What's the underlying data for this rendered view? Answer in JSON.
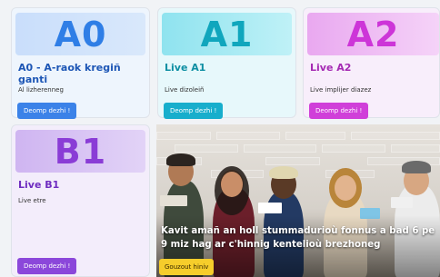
{
  "cards": [
    {
      "code": "A0",
      "title": "A0 - A-raok kregiñ ganti",
      "subtitle": "Al lizherenneg",
      "button": "Deomp dezhi !"
    },
    {
      "code": "A1",
      "title": "Live A1",
      "subtitle": "Live dizoleiñ",
      "button": "Deomp dezhi !"
    },
    {
      "code": "A2",
      "title": "Live A2",
      "subtitle": "Live implijer diazez",
      "button": "Deomp dezhi !"
    },
    {
      "code": "B1",
      "title": "Live B1",
      "subtitle": "Live etre",
      "button": "Deomp dezhi !"
    }
  ],
  "hero": {
    "headline": "Kavit amañ an holl stummadurioù fonnus a bad 6 pe 9 miz hag ar c'hinnig kentelioù brezhoneg",
    "button": "Gouzout hiniv"
  },
  "colors": {
    "a0": "#2f7ee6",
    "a1": "#10a6bd",
    "a2": "#cd35d8",
    "b1": "#8a3cd6",
    "hero_button": "#f6cd2b"
  }
}
